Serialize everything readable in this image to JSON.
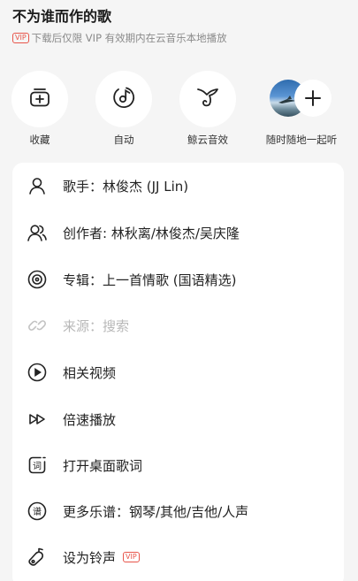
{
  "header": {
    "song_title": "不为谁而作的歌",
    "vip_badge": "VIP",
    "vip_notice": "下载后仅限 VIP 有效期内在云音乐本地播放"
  },
  "quick_actions": [
    {
      "label": "收藏",
      "icon": "add-to-playlist-icon"
    },
    {
      "label": "自动",
      "icon": "auto-sound-effect-icon"
    },
    {
      "label": "鲸云音效",
      "icon": "whale-cloud-sound-icon"
    },
    {
      "label": "随时随地一起听",
      "icon": "listen-together-icon"
    }
  ],
  "menu": {
    "singer": "歌手：林俊杰 (JJ Lin)",
    "creators": "创作者: 林秋离/林俊杰/吴庆隆",
    "album": "专辑：上一首情歌 (国语精选)",
    "source": "来源：搜索",
    "related_video": "相关视频",
    "speed": "倍速播放",
    "desktop_lyrics": "打开桌面歌词",
    "sheet_music": "更多乐谱：钢琴/其他/吉他/人声",
    "ringtone": "设为铃声",
    "ringtone_badge": "VIP"
  },
  "colors": {
    "background": "#f5f5f5",
    "card": "#ffffff",
    "vip_red": "#e8554a",
    "disabled_text": "#b8b8b8"
  }
}
